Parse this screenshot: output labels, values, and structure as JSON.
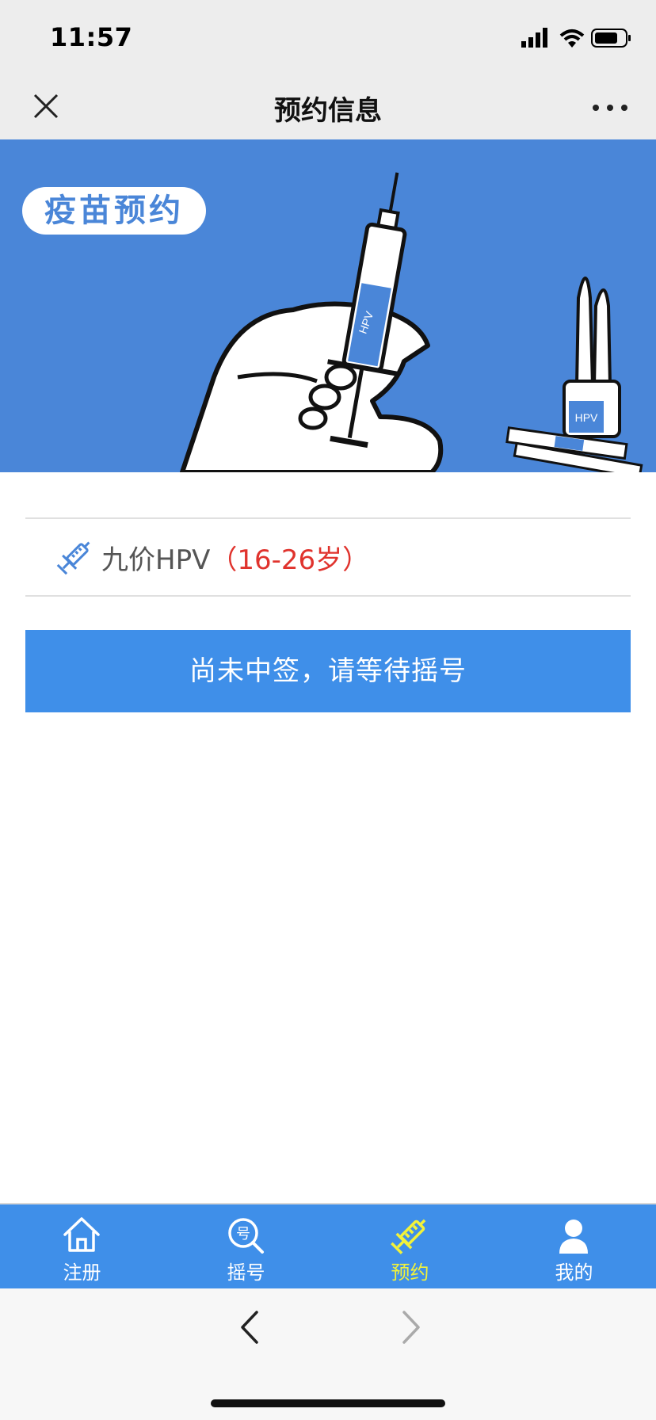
{
  "status_bar": {
    "time": "11:57"
  },
  "nav": {
    "title": "预约信息",
    "close_icon": "close-icon",
    "more_icon": "more-icon"
  },
  "banner": {
    "pill_text": "疫苗预约",
    "syringe_label": "HPV",
    "vial_label": "HPV",
    "bg_color": "#4a86d8"
  },
  "vaccine": {
    "name": "九价HPV",
    "age": "（16-26岁）",
    "icon": "syringe-icon"
  },
  "status_button": {
    "label": "尚未中签，请等待摇号",
    "color": "#3f8fe9"
  },
  "tabs": [
    {
      "label": "注册",
      "icon": "home-icon",
      "active": false
    },
    {
      "label": "摇号",
      "icon": "lottery-search-icon",
      "active": false
    },
    {
      "label": "预约",
      "icon": "syringe-icon",
      "active": true
    },
    {
      "label": "我的",
      "icon": "person-icon",
      "active": false
    }
  ],
  "colors": {
    "accent": "#3f8fe9",
    "active_tab": "#f2f23a",
    "age_red": "#e0332d"
  }
}
